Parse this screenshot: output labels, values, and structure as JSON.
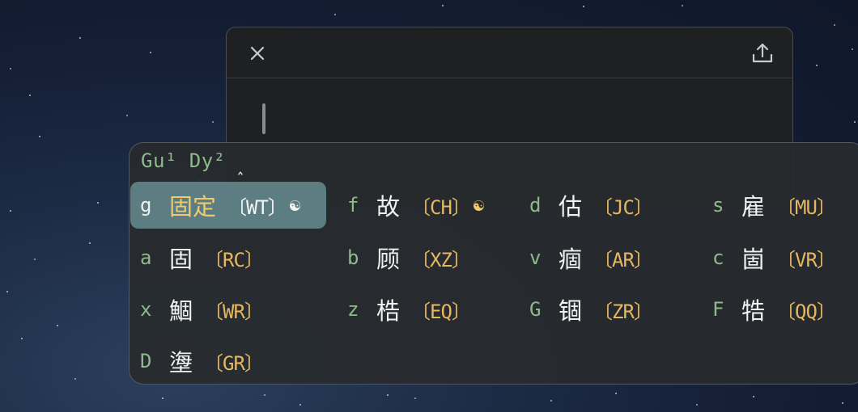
{
  "editor": {
    "close_icon": "close-icon",
    "share_icon": "share-icon"
  },
  "ime": {
    "preedit": "Gu¹ Dy²",
    "cursor": "ˆ",
    "candidates": [
      {
        "key": "g",
        "word": "固定",
        "code": "〔WT〕",
        "mark": "☯",
        "selected": true
      },
      {
        "key": "f",
        "word": "故",
        "code": "〔CH〕",
        "mark": "☯"
      },
      {
        "key": "d",
        "word": "估",
        "code": "〔JC〕"
      },
      {
        "key": "s",
        "word": "雇",
        "code": "〔MU〕"
      },
      {
        "key": "a",
        "word": "固",
        "code": "〔RC〕"
      },
      {
        "key": "b",
        "word": "顾",
        "code": "〔XZ〕"
      },
      {
        "key": "v",
        "word": "痼",
        "code": "〔AR〕"
      },
      {
        "key": "c",
        "word": "崮",
        "code": "〔VR〕"
      },
      {
        "key": "x",
        "word": "鯝",
        "code": "〔WR〕"
      },
      {
        "key": "z",
        "word": "梏",
        "code": "〔EQ〕"
      },
      {
        "key": "G",
        "word": "锢",
        "code": "〔ZR〕"
      },
      {
        "key": "F",
        "word": "牿",
        "code": "〔QQ〕"
      },
      {
        "key": "D",
        "word": "塰",
        "code": "〔GR〕"
      }
    ]
  },
  "colors": {
    "preedit_green": "#8fba8b",
    "code_orange": "#e6b761",
    "selection_bg": "#5c7e83",
    "selected_word": "#f3c96d"
  }
}
